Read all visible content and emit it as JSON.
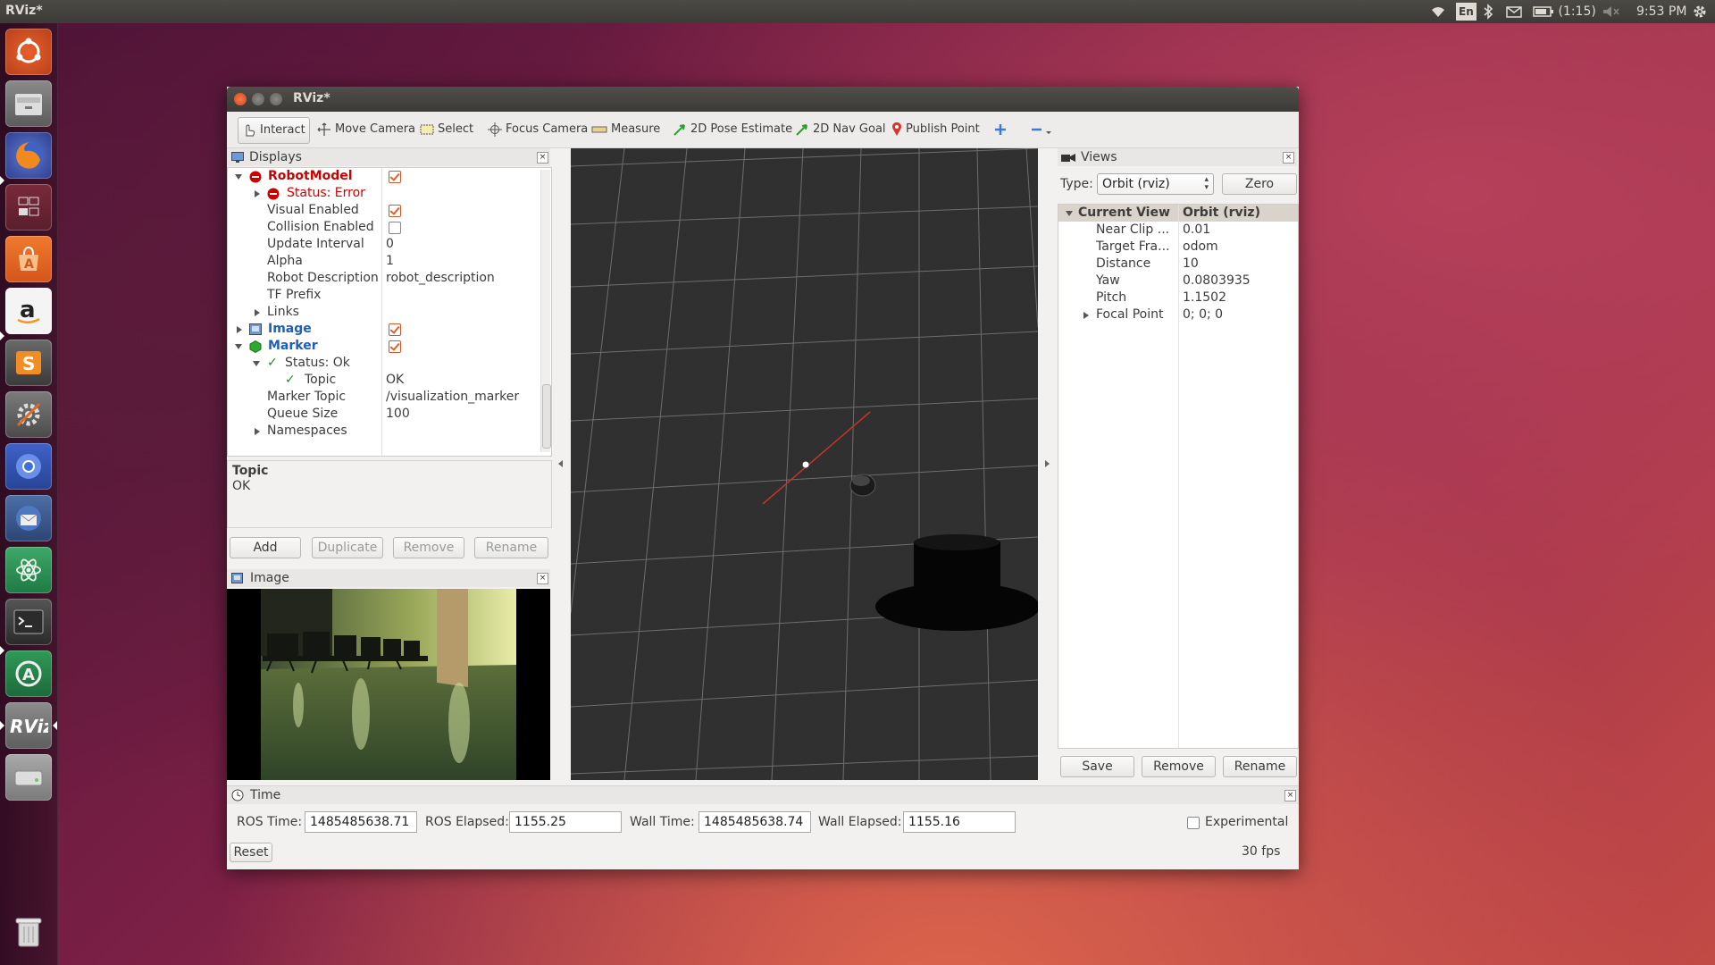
{
  "top_panel": {
    "app_title": "RViz*",
    "keyboard": "En",
    "battery": "(1:15)",
    "clock": "9:53 PM"
  },
  "launcher": {
    "items": [
      "ubuntu-dash",
      "files",
      "firefox",
      "workspaces",
      "software-center",
      "amazon",
      "sublime-text",
      "system-settings",
      "chromium",
      "thunderbird",
      "atom",
      "terminal",
      "software-updater",
      "rviz",
      "disk-drive",
      "trash"
    ]
  },
  "window": {
    "title": "RViz*",
    "toolbar": {
      "interact": "Interact",
      "move_camera": "Move Camera",
      "select": "Select",
      "focus_camera": "Focus Camera",
      "measure": "Measure",
      "pose_estimate": "2D Pose Estimate",
      "nav_goal": "2D Nav Goal",
      "publish_point": "Publish Point"
    },
    "displays": {
      "title": "Displays",
      "rows": [
        {
          "label": "RobotModel",
          "value": "",
          "checked": true
        },
        {
          "label": "Status: Error",
          "value": ""
        },
        {
          "label": "Visual Enabled",
          "value": "",
          "checked": true
        },
        {
          "label": "Collision Enabled",
          "value": "",
          "checked": false
        },
        {
          "label": "Update Interval",
          "value": "0"
        },
        {
          "label": "Alpha",
          "value": "1"
        },
        {
          "label": "Robot Description",
          "value": "robot_description"
        },
        {
          "label": "TF Prefix",
          "value": ""
        },
        {
          "label": "Links",
          "value": ""
        },
        {
          "label": "Image",
          "value": "",
          "checked": true
        },
        {
          "label": "Marker",
          "value": "",
          "checked": true
        },
        {
          "label": "Status: Ok",
          "value": ""
        },
        {
          "label": "Topic",
          "value": "OK"
        },
        {
          "label": "Marker Topic",
          "value": "/visualization_marker"
        },
        {
          "label": "Queue Size",
          "value": "100"
        },
        {
          "label": "Namespaces",
          "value": ""
        }
      ],
      "description_title": "Topic",
      "description_text": "OK",
      "buttons": {
        "add": "Add",
        "duplicate": "Duplicate",
        "remove": "Remove",
        "rename": "Rename"
      }
    },
    "image_panel": {
      "title": "Image"
    },
    "views": {
      "title": "Views",
      "type_label": "Type:",
      "type_value": "Orbit (rviz)",
      "zero_button": "Zero",
      "rows": [
        {
          "label": "Current View",
          "value": "Orbit (rviz)"
        },
        {
          "label": "Near Clip ...",
          "value": "0.01"
        },
        {
          "label": "Target Fra...",
          "value": "odom"
        },
        {
          "label": "Distance",
          "value": "10"
        },
        {
          "label": "Yaw",
          "value": "0.0803935"
        },
        {
          "label": "Pitch",
          "value": "1.1502"
        },
        {
          "label": "Focal Point",
          "value": "0; 0; 0"
        }
      ],
      "buttons": {
        "save": "Save",
        "remove": "Remove",
        "rename": "Rename"
      }
    },
    "time": {
      "title": "Time",
      "ros_time_label": "ROS Time:",
      "ros_time": "1485485638.71",
      "ros_elapsed_label": "ROS Elapsed:",
      "ros_elapsed": "1155.25",
      "wall_time_label": "Wall Time:",
      "wall_time": "1485485638.74",
      "wall_elapsed_label": "Wall Elapsed:",
      "wall_elapsed": "1155.16",
      "experimental_label": "Experimental",
      "reset_button": "Reset",
      "fps": "30 fps"
    }
  },
  "colors": {
    "error": "#cc0000",
    "display_blue": "#1f5fb7",
    "ok_green": "#2a8a2a",
    "accent_orange": "#e0602a",
    "viewport_bg": "#303030"
  }
}
